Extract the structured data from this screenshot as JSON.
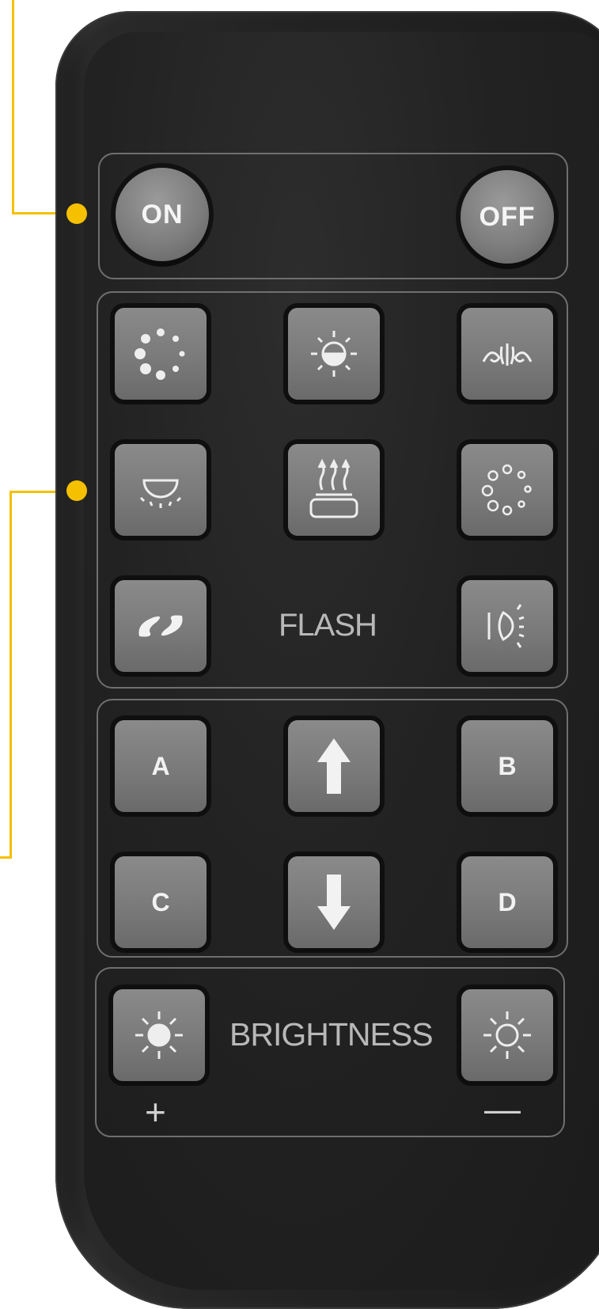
{
  "buttons": {
    "on": "ON",
    "off": "OFF",
    "a": "A",
    "b": "B",
    "c": "C",
    "d": "D"
  },
  "labels": {
    "flash": "FLASH",
    "brightness": "BRIGHTNESS",
    "plus": "+",
    "minus": "—"
  },
  "icons": {
    "mode_1": "dot-ring-icon",
    "mode_2": "sun-half-icon",
    "mode_3": "splash-icon",
    "mode_4": "downlight-icon",
    "mode_5": "steam-icon",
    "mode_6": "circle-dots-icon",
    "mode_7": "swirl-icon",
    "mode_8": "headlight-icon",
    "up": "arrow-up-icon",
    "down": "arrow-down-icon",
    "bright_up": "sun-filled-icon",
    "bright_down": "sun-outline-icon"
  },
  "colors": {
    "callout": "#f5c000",
    "button": "#7a7a7a",
    "body": "#1e1e1e"
  }
}
